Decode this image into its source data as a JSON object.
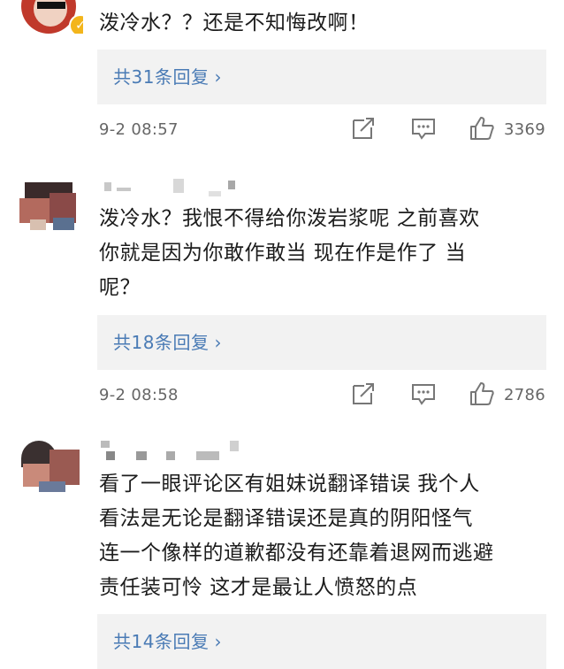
{
  "comments": [
    {
      "text": "泼冷水？？还是不知悔改啊！",
      "reply_label": "共31条回复",
      "chevron": "›",
      "time": "9-2 08:57",
      "likes": "3369"
    },
    {
      "text": "泼冷水？我恨不得给你泼岩浆呢 之前喜欢\n你就是因为你敢作敢当 现在作是作了 当\n呢？",
      "reply_label": "共18条回复",
      "chevron": "›",
      "time": "9-2 08:58",
      "likes": "2786"
    },
    {
      "text": "看了一眼评论区有姐妹说翻译错误 我个人\n看法是无论是翻译错误还是真的阴阳怪气\n连一个像样的道歉都没有还靠着退网而逃避\n责任装可怜 这才是最让人愤怒的点",
      "reply_label": "共14条回复",
      "chevron": "›"
    }
  ],
  "icons": {
    "share": "share-icon",
    "comment": "comment-icon",
    "like": "thumbs-up-icon",
    "verified": "verified-badge-icon"
  },
  "colors": {
    "link": "#4a7bb5",
    "reply_bg": "#f2f2f2",
    "meta_text": "#666666",
    "verified": "#f3b51b"
  }
}
